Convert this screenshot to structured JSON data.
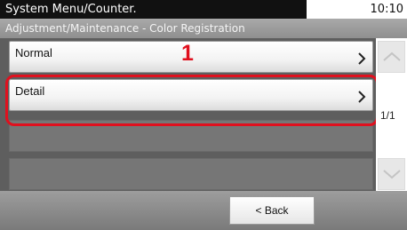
{
  "header": {
    "title": "System Menu/Counter.",
    "time": "10:10"
  },
  "breadcrumb": "Adjustment/Maintenance - Color Registration",
  "list": {
    "items": [
      {
        "label": "Normal"
      },
      {
        "label": "Detail"
      }
    ],
    "empty_rows": 2
  },
  "annotation": {
    "callout_number": "1"
  },
  "pagination": {
    "text": "1/1"
  },
  "footer": {
    "back_label": "< Back"
  },
  "colors": {
    "highlight": "#e0101e",
    "content_background": "#5e5e5e",
    "title_bar": "#111111"
  },
  "icons": [
    "chevron-right-icon",
    "scroll-up-icon",
    "scroll-down-icon"
  ]
}
